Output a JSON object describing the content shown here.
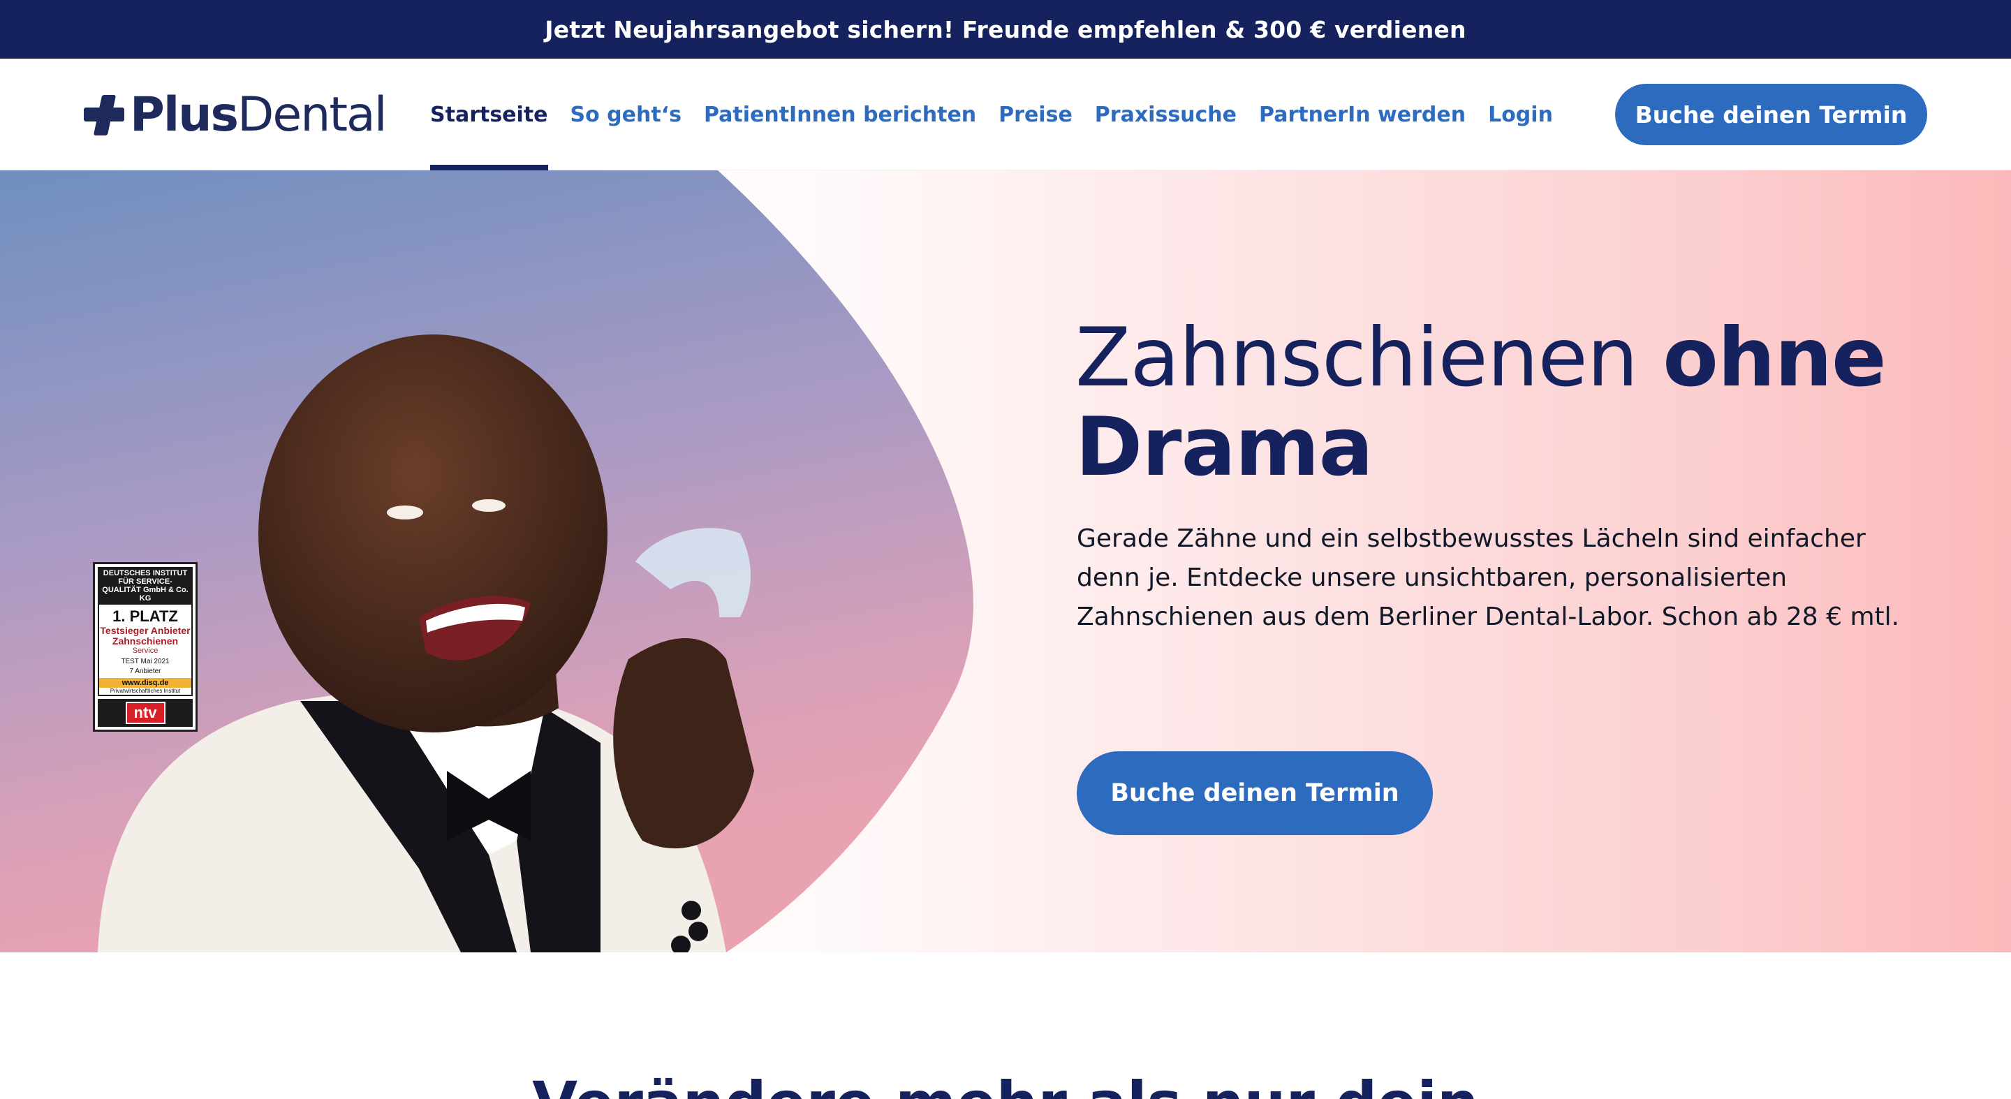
{
  "promo": {
    "text": "Jetzt Neujahrsangebot sichern! Freunde empfehlen & 300 € verdienen"
  },
  "header": {
    "logo": {
      "part1": "Plus",
      "part2": "Dental"
    },
    "nav": [
      {
        "label": "Startseite",
        "active": true
      },
      {
        "label": "So geht‘s",
        "active": false
      },
      {
        "label": "PatientInnen berichten",
        "active": false
      },
      {
        "label": "Preise",
        "active": false
      },
      {
        "label": "Praxissuche",
        "active": false
      },
      {
        "label": "PartnerIn werden",
        "active": false
      },
      {
        "label": "Login",
        "active": false
      }
    ],
    "cta_label": "Buche deinen Termin"
  },
  "hero": {
    "title_regular": "Zahnschienen",
    "title_bold_1": "ohne",
    "title_bold_2": "Drama",
    "text": "Gerade Zähne und ein selbstbewusstes Lächeln sind einfacher denn je. Entdecke unsere unsichtbaren, personalisierten Zahnschienen aus dem Berliner Dental-Labor. Schon ab 28 € mtl.",
    "cta_label": "Buche deinen Termin"
  },
  "badge": {
    "head": "DEUTSCHES INSTITUT FÜR SERVICE-QUALITÄT GmbH & Co. KG",
    "rank": "1. PLATZ",
    "title": "Testsieger Anbieter Zahnschienen",
    "sub": "Service",
    "test_line_1": "TEST Mai 2021",
    "test_line_2": "7 Anbieter",
    "url": "www.disq.de",
    "institute": "Privatwirtschaftliches Institut",
    "logo": "ntv"
  },
  "next_section": {
    "heading": "Verändere mehr als nur dein"
  },
  "colors": {
    "navy": "#16225e",
    "accent_blue": "#2d6bbf",
    "hero_pink": "#fcb8b9"
  }
}
